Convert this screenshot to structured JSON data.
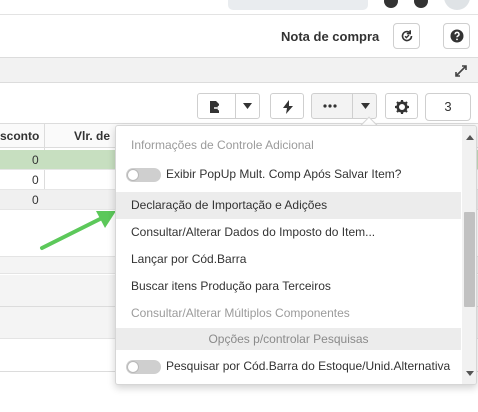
{
  "header": {
    "title": "Nota de compra"
  },
  "toolbar": {
    "quantity_value": "3"
  },
  "grid": {
    "columns": [
      "sconto",
      "Vlr. de"
    ],
    "rows": [
      {
        "desconto": "0"
      },
      {
        "desconto": "0"
      },
      {
        "desconto": "0"
      }
    ],
    "highlight_color": "#c7dfc0"
  },
  "dropdown": {
    "items": [
      {
        "label": "Informações de Controle Adicional",
        "state": "disabled"
      },
      {
        "label": "Exibir PopUp Mult. Comp Após Salvar Item?",
        "toggle": "off"
      },
      {
        "label": "Declaração de Importação e Adições",
        "state": "hover"
      },
      {
        "label": "Consultar/Alterar Dados do Imposto do Item..."
      },
      {
        "label": "Lançar por Cód.Barra"
      },
      {
        "label": "Buscar itens Produção para Terceiros"
      },
      {
        "label": "Consultar/Alterar Múltiplos Componentes",
        "state": "disabled"
      },
      {
        "label": "Opções p/controlar Pesquisas",
        "state": "section-header"
      },
      {
        "label": "Pesquisar por Cód.Barra do Estoque/Unid.Alternativa",
        "toggle": "off"
      }
    ]
  },
  "colors": {
    "annotation_arrow": "#5cc85a",
    "menu_hover": "#ececec"
  },
  "icons": {
    "header_refresh": "refresh-icon",
    "header_help": "help-icon",
    "expand": "expand-icon",
    "toolbar_export": "export-file-icon",
    "toolbar_action": "lightning-icon",
    "toolbar_more": "ellipsis-icon",
    "toolbar_settings": "gear-icon"
  }
}
